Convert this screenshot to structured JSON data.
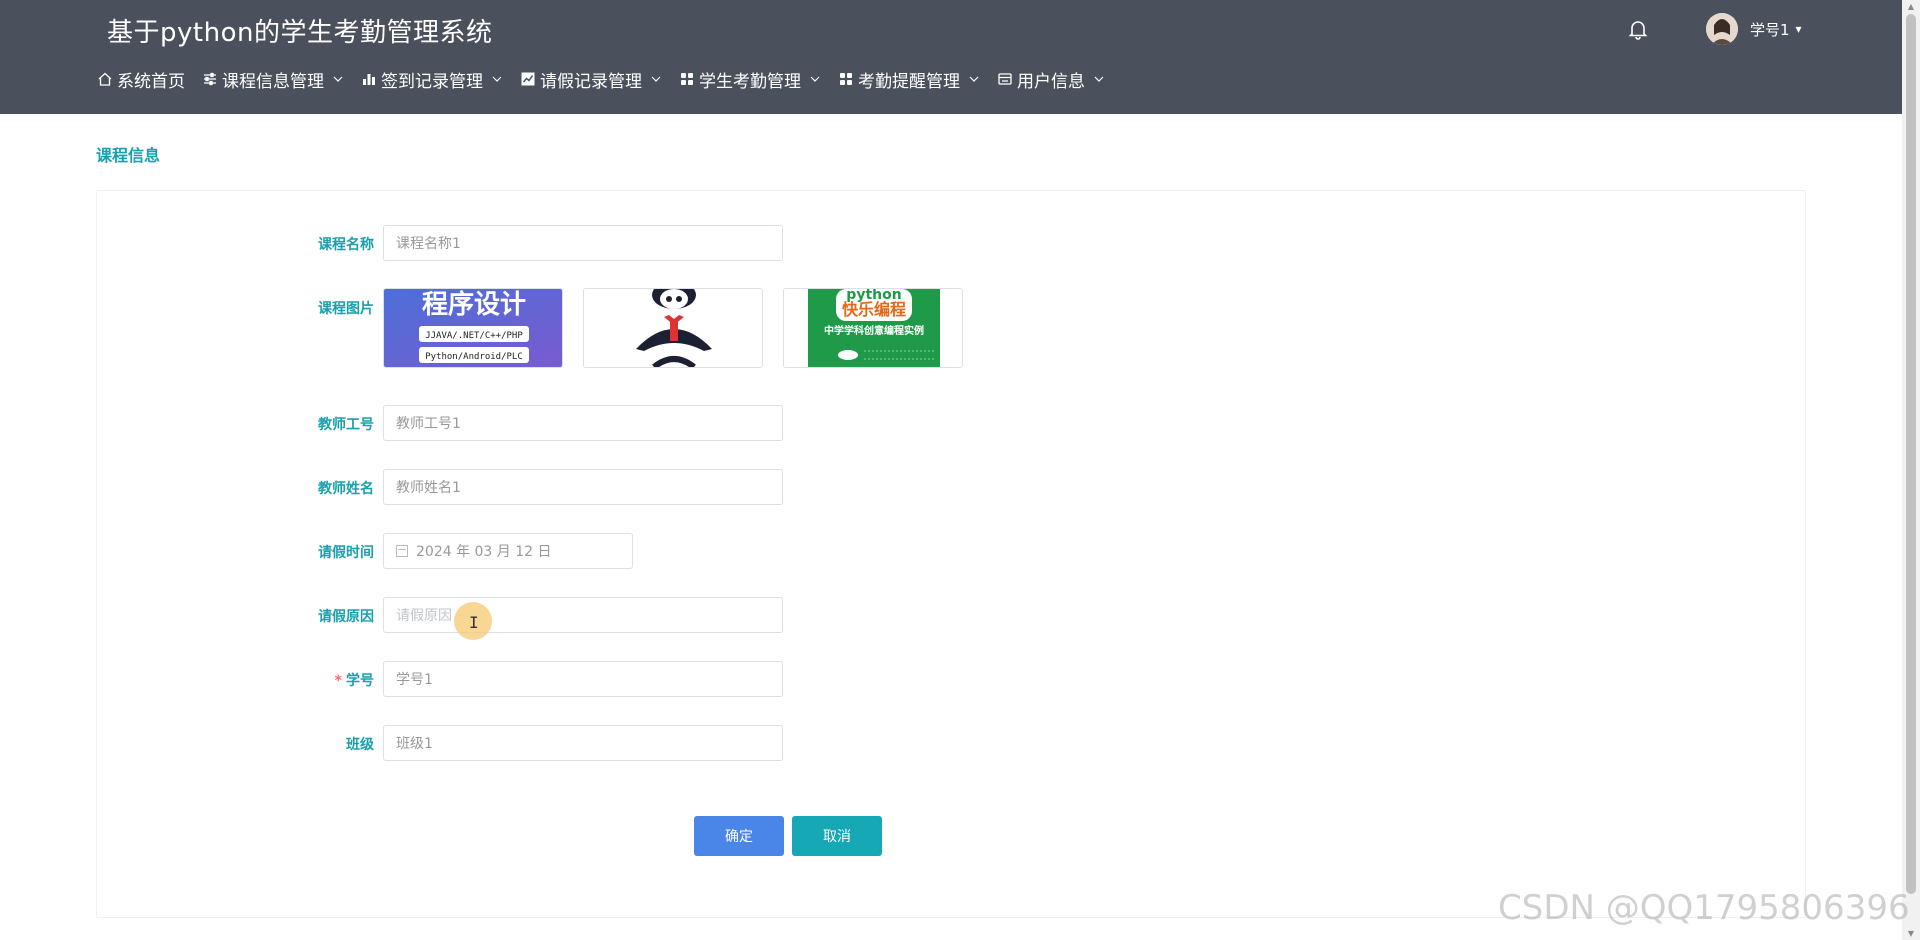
{
  "header": {
    "site_title": "基于python的学生考勤管理系统",
    "user_name": "学号1",
    "caret": "▾"
  },
  "nav": {
    "items": [
      {
        "label": "系统首页",
        "icon": "home-icon",
        "has_dropdown": false
      },
      {
        "label": "课程信息管理",
        "icon": "sliders-icon",
        "has_dropdown": true
      },
      {
        "label": "签到记录管理",
        "icon": "bar-chart-icon",
        "has_dropdown": true
      },
      {
        "label": "请假记录管理",
        "icon": "line-chart-icon",
        "has_dropdown": true
      },
      {
        "label": "学生考勤管理",
        "icon": "grid-icon",
        "has_dropdown": true
      },
      {
        "label": "考勤提醒管理",
        "icon": "grid-icon",
        "has_dropdown": true
      },
      {
        "label": "用户信息",
        "icon": "card-icon",
        "has_dropdown": true
      }
    ]
  },
  "page": {
    "title": "课程信息"
  },
  "form": {
    "course_name": {
      "label": "课程名称",
      "value": "课程名称1"
    },
    "course_image": {
      "label": "课程图片",
      "images": [
        {
          "name": "image-programming-design",
          "line1": "程序设计",
          "line2": "JJAVA/.NET/C++/PHP",
          "line3": "Python/Android/PLC"
        },
        {
          "name": "image-cartoon-penguin"
        },
        {
          "name": "image-python-book",
          "line1": "python",
          "line2": "快乐编程",
          "line3": "中学学科创意编程实例"
        }
      ]
    },
    "teacher_id": {
      "label": "教师工号",
      "value": "教师工号1"
    },
    "teacher_name": {
      "label": "教师姓名",
      "value": "教师姓名1"
    },
    "leave_time": {
      "label": "请假时间",
      "value": "2024 年 03 月 12 日"
    },
    "leave_reason": {
      "label": "请假原因",
      "placeholder": "请假原因"
    },
    "student_id": {
      "label": "学号",
      "required_mark": "*",
      "value": "学号1"
    },
    "class_name": {
      "label": "班级",
      "value": "班级1"
    }
  },
  "buttons": {
    "confirm": "确定",
    "cancel": "取消"
  },
  "watermark": "CSDN @QQ1795806396",
  "colors": {
    "header_bg": "#4a505c",
    "accent_label": "#1aa0ad",
    "confirm_btn": "#4a86e8",
    "cancel_btn": "#17a8b5"
  }
}
